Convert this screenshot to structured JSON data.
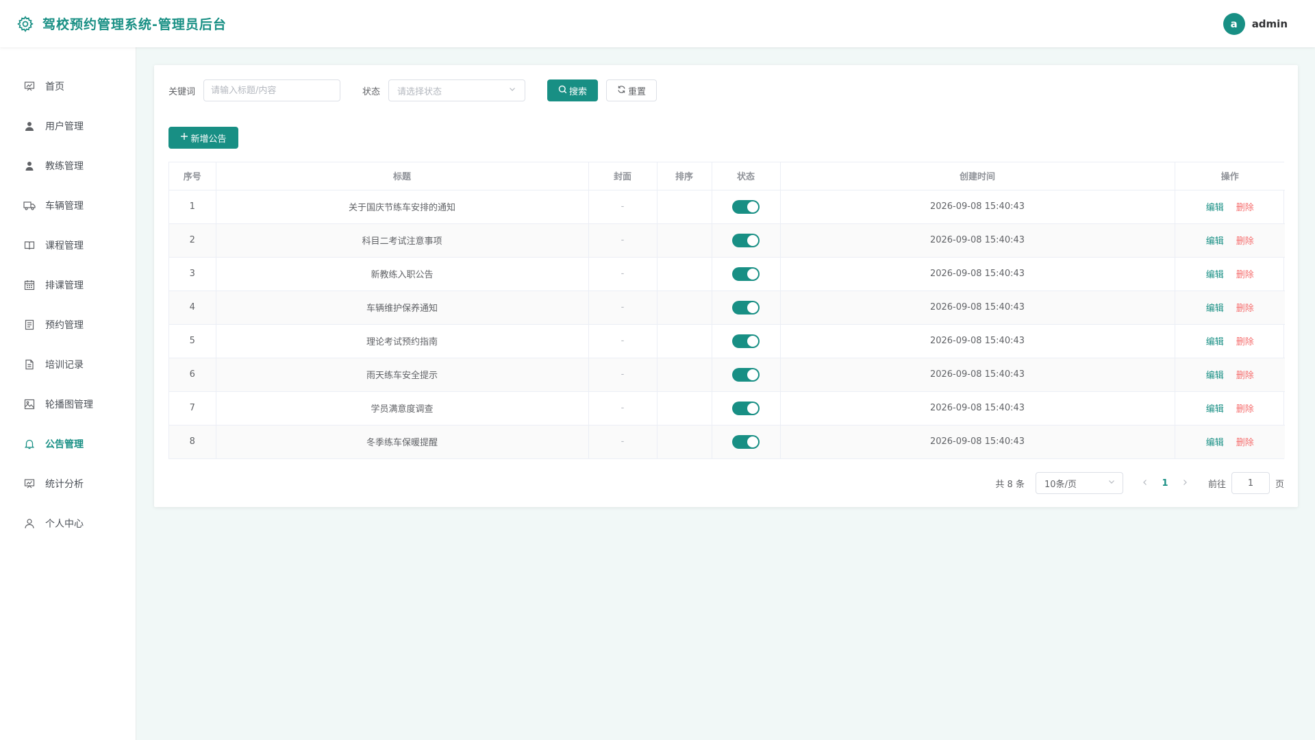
{
  "app": {
    "title": "驾校预约管理系统-管理员后台",
    "brand_color": "#188f84"
  },
  "user": {
    "avatar_letter": "a",
    "name": "admin"
  },
  "sidebar": {
    "items": [
      {
        "label": "首页",
        "icon": "dashboard-icon",
        "active": false
      },
      {
        "label": "用户管理",
        "icon": "user-icon",
        "active": false
      },
      {
        "label": "教练管理",
        "icon": "coach-icon",
        "active": false
      },
      {
        "label": "车辆管理",
        "icon": "truck-icon",
        "active": false
      },
      {
        "label": "课程管理",
        "icon": "book-icon",
        "active": false
      },
      {
        "label": "排课管理",
        "icon": "calendar-icon",
        "active": false
      },
      {
        "label": "预约管理",
        "icon": "document-icon",
        "active": false
      },
      {
        "label": "培训记录",
        "icon": "file-icon",
        "active": false
      },
      {
        "label": "轮播图管理",
        "icon": "image-icon",
        "active": false
      },
      {
        "label": "公告管理",
        "icon": "bell-icon",
        "active": true
      },
      {
        "label": "统计分析",
        "icon": "chart-icon",
        "active": false
      },
      {
        "label": "个人中心",
        "icon": "profile-icon",
        "active": false
      }
    ]
  },
  "search": {
    "keyword_label": "关键词",
    "keyword_placeholder": "请输入标题/内容",
    "status_label": "状态",
    "status_placeholder": "请选择状态",
    "search_button": "搜索",
    "reset_button": "重置"
  },
  "toolbar": {
    "add_button": "新增公告"
  },
  "table": {
    "headers": [
      "序号",
      "标题",
      "封面",
      "排序",
      "状态",
      "创建时间",
      "操作"
    ],
    "edit_label": "编辑",
    "delete_label": "删除",
    "rows": [
      {
        "index": "1",
        "title": "关于国庆节练车安排的通知",
        "cover": "-",
        "sort": "",
        "enabled": true,
        "created": "2026-09-08 15:40:43"
      },
      {
        "index": "2",
        "title": "科目二考试注意事项",
        "cover": "-",
        "sort": "",
        "enabled": true,
        "created": "2026-09-08 15:40:43"
      },
      {
        "index": "3",
        "title": "新教练入职公告",
        "cover": "-",
        "sort": "",
        "enabled": true,
        "created": "2026-09-08 15:40:43"
      },
      {
        "index": "4",
        "title": "车辆维护保养通知",
        "cover": "-",
        "sort": "",
        "enabled": true,
        "created": "2026-09-08 15:40:43"
      },
      {
        "index": "5",
        "title": "理论考试预约指南",
        "cover": "-",
        "sort": "",
        "enabled": true,
        "created": "2026-09-08 15:40:43"
      },
      {
        "index": "6",
        "title": "雨天练车安全提示",
        "cover": "-",
        "sort": "",
        "enabled": true,
        "created": "2026-09-08 15:40:43"
      },
      {
        "index": "7",
        "title": "学员满意度调查",
        "cover": "-",
        "sort": "",
        "enabled": true,
        "created": "2026-09-08 15:40:43"
      },
      {
        "index": "8",
        "title": "冬季练车保暖提醒",
        "cover": "-",
        "sort": "",
        "enabled": true,
        "created": "2026-09-08 15:40:43"
      }
    ]
  },
  "pagination": {
    "total_text": "共 8 条",
    "page_size": "10条/页",
    "current_page": "1",
    "goto_label": "前往",
    "goto_value": "1",
    "page_suffix": "页"
  }
}
